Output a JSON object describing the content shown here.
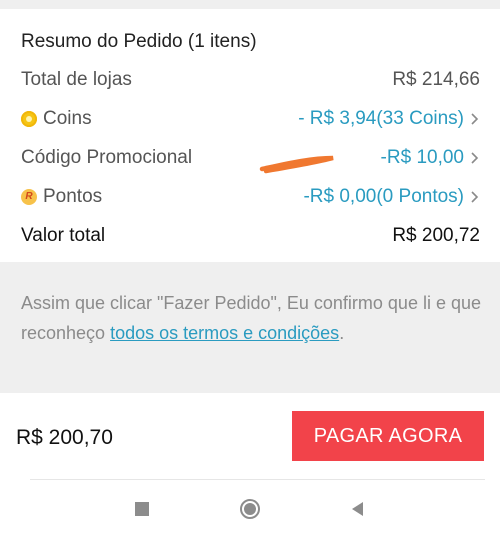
{
  "summary": {
    "title": "Resumo do Pedido (1 itens)",
    "rows": [
      {
        "label": "Total de lojas",
        "value": "R$ 214,66"
      },
      {
        "label": "Coins",
        "value": "- R$ 3,94(33 Coins)",
        "icon": "coin-icon"
      },
      {
        "label": "Código Promocional",
        "value": "-R$ 10,00"
      },
      {
        "label": "Pontos",
        "value": "-R$ 0,00(0 Pontos)",
        "icon": "points-icon",
        "icon_text": "R"
      }
    ],
    "total": {
      "label": "Valor total",
      "value": "R$ 200,72"
    }
  },
  "terms": {
    "text": "Assim que clicar \"Fazer Pedido\", Eu confirmo que li e que reconheço ",
    "link": "todos os termos e condições",
    "end": "."
  },
  "footer": {
    "price": "R$ 200,70",
    "pay_label": "PAGAR AGORA"
  },
  "colors": {
    "accent_link": "#2a9bc0",
    "pay_button": "#f2434a",
    "scribble": "#f07830"
  },
  "navbar": {
    "icons": [
      "square-recent-icon",
      "circle-home-icon",
      "triangle-back-icon"
    ]
  }
}
